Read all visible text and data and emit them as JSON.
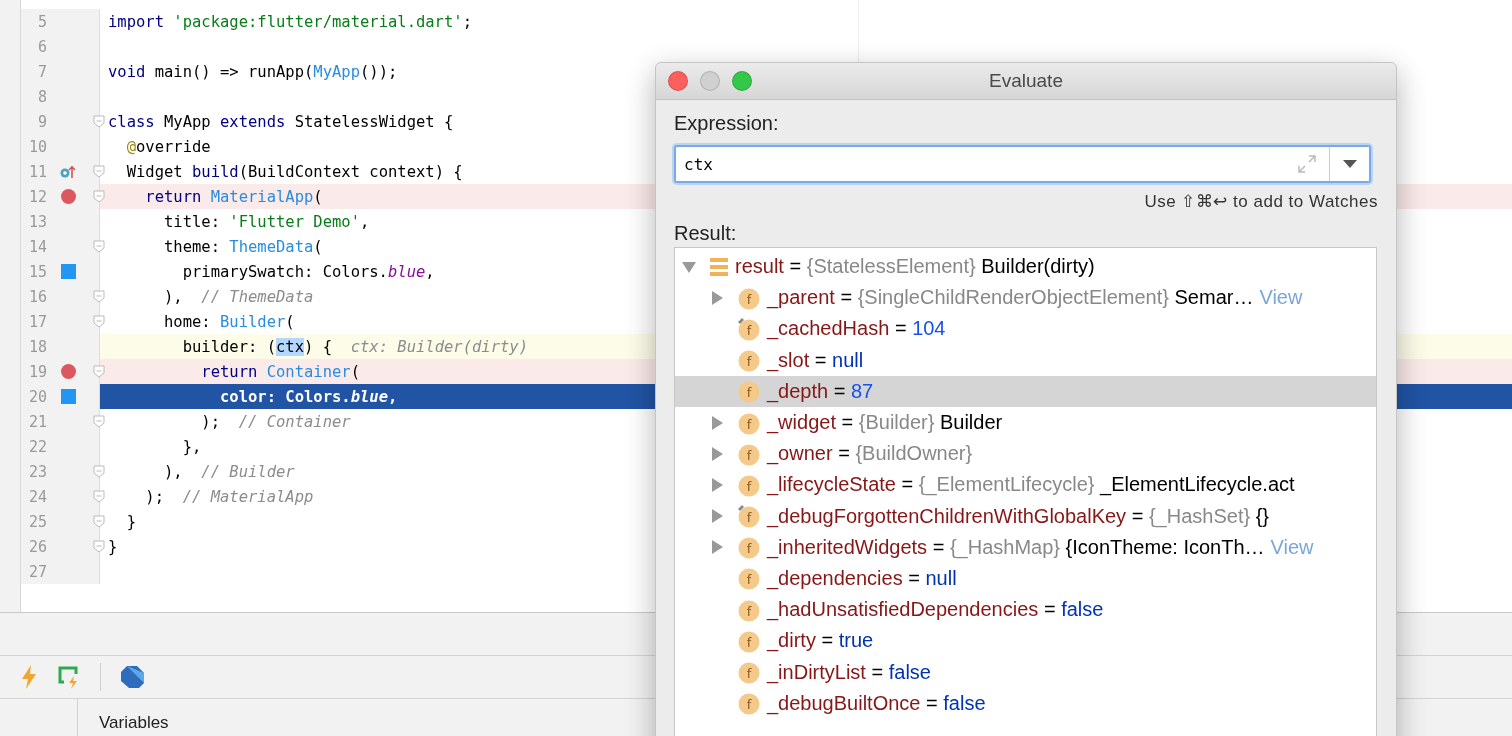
{
  "editor": {
    "lines": [
      {
        "number": "5",
        "tokens": [
          {
            "kind": "keyword",
            "text": "import"
          },
          {
            "kind": "string",
            "text": " 'package:flutter/material.dart'"
          },
          {
            "kind": "plain",
            "text": ";"
          }
        ]
      },
      {
        "number": "6"
      },
      {
        "number": "7",
        "tokens": [
          {
            "kind": "keyword",
            "text": "void"
          },
          {
            "kind": "plain",
            "text": " main() => runApp("
          },
          {
            "kind": "class",
            "text": "MyApp"
          },
          {
            "kind": "plain",
            "text": "());"
          }
        ]
      },
      {
        "number": "8"
      },
      {
        "number": "9",
        "fold": true,
        "tokens": [
          {
            "kind": "keyword",
            "text": "class"
          },
          {
            "kind": "plain",
            "text": " MyApp "
          },
          {
            "kind": "keyword",
            "text": "extends"
          },
          {
            "kind": "plain",
            "text": " StatelessWidget {"
          }
        ]
      },
      {
        "number": "10",
        "tokens": [
          {
            "kind": "annotation",
            "text": "  @"
          },
          {
            "kind": "plain",
            "text": "override"
          }
        ]
      },
      {
        "number": "11",
        "override": true,
        "fold": true,
        "tokens": [
          {
            "kind": "plain",
            "text": "  Widget "
          },
          {
            "kind": "keyword",
            "text": "build"
          },
          {
            "kind": "plain",
            "text": "(BuildContext context) {"
          }
        ]
      },
      {
        "number": "12",
        "breakpoint": true,
        "fold": true,
        "tokens": [
          {
            "kind": "keyword",
            "text": "    return"
          },
          {
            "kind": "class",
            "text": " MaterialApp"
          },
          {
            "kind": "plain",
            "text": "("
          }
        ]
      },
      {
        "number": "13",
        "tokens": [
          {
            "kind": "plain",
            "text": "      title: "
          },
          {
            "kind": "string",
            "text": "'Flutter Demo'"
          },
          {
            "kind": "plain",
            "text": ","
          }
        ]
      },
      {
        "number": "14",
        "fold": true,
        "tokens": [
          {
            "kind": "plain",
            "text": "      theme: "
          },
          {
            "kind": "class",
            "text": "ThemeData"
          },
          {
            "kind": "plain",
            "text": "("
          }
        ]
      },
      {
        "number": "15",
        "swatch": true,
        "tokens": [
          {
            "kind": "plain",
            "text": "        primarySwatch: Colors."
          },
          {
            "kind": "constant",
            "text": "blue"
          },
          {
            "kind": "plain",
            "text": ","
          }
        ]
      },
      {
        "number": "16",
        "fold": true,
        "tokens": [
          {
            "kind": "plain",
            "text": "      ),  "
          },
          {
            "kind": "comment",
            "text": "// ThemeData"
          }
        ]
      },
      {
        "number": "17",
        "fold": true,
        "tokens": [
          {
            "kind": "plain",
            "text": "      home: "
          },
          {
            "kind": "class",
            "text": "Builder"
          },
          {
            "kind": "plain",
            "text": "("
          }
        ]
      },
      {
        "number": "18",
        "current": true,
        "tokens": [
          {
            "kind": "plain",
            "text": "        builder: ("
          },
          {
            "kind": "usage",
            "text": "ctx"
          },
          {
            "kind": "plain",
            "text": ") {  "
          },
          {
            "kind": "hint",
            "text": "ctx: Builder(dirty)"
          }
        ]
      },
      {
        "number": "19",
        "breakpoint": true,
        "fold": true,
        "tokens": [
          {
            "kind": "keyword",
            "text": "          return"
          },
          {
            "kind": "class",
            "text": " Container"
          },
          {
            "kind": "plain",
            "text": "("
          }
        ]
      },
      {
        "number": "20",
        "swatch": true,
        "execution": true,
        "tokens": [
          {
            "kind": "plain",
            "text": "            color: Colors."
          },
          {
            "kind": "constant",
            "text": "blue"
          },
          {
            "kind": "plain",
            "text": ","
          }
        ]
      },
      {
        "number": "21",
        "fold": true,
        "tokens": [
          {
            "kind": "plain",
            "text": "          );  "
          },
          {
            "kind": "comment",
            "text": "// Container"
          }
        ]
      },
      {
        "number": "22",
        "tokens": [
          {
            "kind": "plain",
            "text": "        },"
          }
        ]
      },
      {
        "number": "23",
        "fold": true,
        "tokens": [
          {
            "kind": "plain",
            "text": "      ),  "
          },
          {
            "kind": "comment",
            "text": "// Builder"
          }
        ]
      },
      {
        "number": "24",
        "fold": true,
        "tokens": [
          {
            "kind": "plain",
            "text": "    );  "
          },
          {
            "kind": "comment",
            "text": "// MaterialApp"
          }
        ]
      },
      {
        "number": "25",
        "fold": true,
        "tokens": [
          {
            "kind": "plain",
            "text": "  }"
          }
        ]
      },
      {
        "number": "26",
        "fold": true,
        "tokens": [
          {
            "kind": "plain",
            "text": "}"
          }
        ]
      },
      {
        "number": "27"
      }
    ]
  },
  "debug_panel": {
    "tab": "Variables"
  },
  "dialog": {
    "title": "Evaluate",
    "expression_label": "Expression:",
    "expression": {
      "value": "ctx"
    },
    "hint": "Use ⇧⌘↩ to add to Watches",
    "result_label": "Result:",
    "result": [
      {
        "kind": "list",
        "name": "result",
        "operator": "=",
        "type": "{StatelessElement}",
        "value": {
          "kind": "text",
          "text": "Builder(dirty)"
        },
        "expanded": true,
        "selected": false,
        "children": [
          {
            "kind": "field",
            "badge": "f",
            "name": "_parent",
            "operator": "=",
            "type": "{SingleChildRenderObjectElement}",
            "value": {
              "kind": "text",
              "text": "Semar…"
            },
            "link": "View",
            "expanded": false,
            "selected": false
          },
          {
            "kind": "field",
            "badge": "f",
            "marked": true,
            "name": "_cachedHash",
            "operator": "=",
            "value": {
              "kind": "number",
              "text": "104"
            },
            "selected": false
          },
          {
            "kind": "field",
            "badge": "f",
            "name": "_slot",
            "operator": "=",
            "value": {
              "kind": "keyword",
              "text": "null"
            },
            "selected": false
          },
          {
            "kind": "field",
            "badge": "f",
            "name": "_depth",
            "operator": "=",
            "value": {
              "kind": "number",
              "text": "87"
            },
            "selected": true
          },
          {
            "kind": "field",
            "badge": "f",
            "name": "_widget",
            "operator": "=",
            "type": "{Builder}",
            "value": {
              "kind": "text",
              "text": "Builder"
            },
            "expanded": false,
            "selected": false
          },
          {
            "kind": "field",
            "badge": "f",
            "name": "_owner",
            "operator": "=",
            "type": "{BuildOwner}",
            "expanded": false,
            "selected": false
          },
          {
            "kind": "field",
            "badge": "f",
            "name": "_lifecycleState",
            "operator": "=",
            "type": "{_ElementLifecycle}",
            "value": {
              "kind": "text",
              "text": "_ElementLifecycle.act"
            },
            "expanded": false,
            "selected": false
          },
          {
            "kind": "field",
            "badge": "f",
            "marked": true,
            "name": "_debugForgottenChildrenWithGlobalKey",
            "operator": "=",
            "type": "{_HashSet}",
            "value": {
              "kind": "text",
              "text": "{}"
            },
            "expanded": false,
            "selected": false
          },
          {
            "kind": "field",
            "badge": "f",
            "name": "_inheritedWidgets",
            "operator": "=",
            "type": "{_HashMap}",
            "value": {
              "kind": "text",
              "text": "{IconTheme: IconTh…"
            },
            "link": "View",
            "expanded": false,
            "selected": false
          },
          {
            "kind": "field",
            "badge": "f",
            "name": "_dependencies",
            "operator": "=",
            "value": {
              "kind": "keyword",
              "text": "null"
            },
            "selected": false
          },
          {
            "kind": "field",
            "badge": "f",
            "name": "_hadUnsatisfiedDependencies",
            "operator": "=",
            "value": {
              "kind": "keyword",
              "text": "false"
            },
            "selected": false
          },
          {
            "kind": "field",
            "badge": "f",
            "name": "_dirty",
            "operator": "=",
            "value": {
              "kind": "keyword",
              "text": "true"
            },
            "selected": false
          },
          {
            "kind": "field",
            "badge": "f",
            "name": "_inDirtyList",
            "operator": "=",
            "value": {
              "kind": "keyword",
              "text": "false"
            },
            "selected": false
          },
          {
            "kind": "field",
            "badge": "f",
            "name": "_debugBuiltOnce",
            "operator": "=",
            "value": {
              "kind": "keyword",
              "text": "false"
            },
            "selected": false
          }
        ]
      }
    ]
  }
}
